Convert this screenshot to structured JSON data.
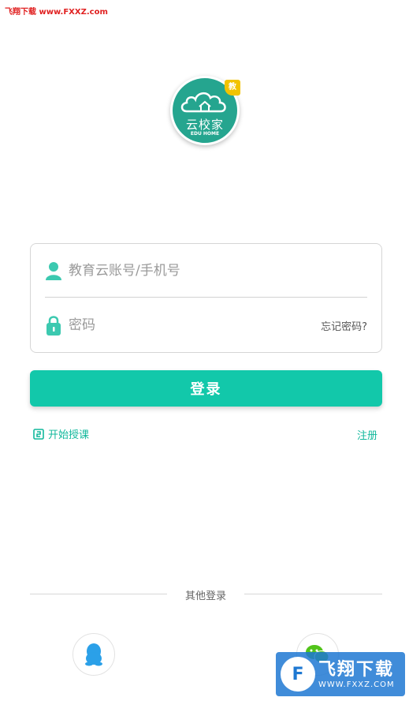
{
  "watermark": {
    "top_text": "飞翔下载 www.FXXZ.com",
    "bottom_main": "飞翔下载",
    "bottom_url": "WWW.FXXZ.COM",
    "bottom_logo_glyph": "F"
  },
  "logo": {
    "badge": "教",
    "name": "云校家",
    "sub": "EDU HOME"
  },
  "form": {
    "account_placeholder": "教育云账号/手机号",
    "account_value": "",
    "password_placeholder": "密码",
    "password_value": "",
    "forgot_label": "忘记密码?",
    "account_icon": "user-icon",
    "password_icon": "lock-icon"
  },
  "actions": {
    "login_label": "登录",
    "start_class_label": "开始授课",
    "start_class_icon": "start-class-icon",
    "register_label": "注册"
  },
  "other_login": {
    "label": "其他登录",
    "providers": [
      {
        "name": "QQ",
        "icon": "qq-icon"
      },
      {
        "name": "WeChat",
        "icon": "wechat-icon"
      }
    ]
  },
  "colors": {
    "accent": "#12c8aa",
    "logo_bg": "#25a58f",
    "link": "#12b89c",
    "badge": "#f2c300"
  }
}
